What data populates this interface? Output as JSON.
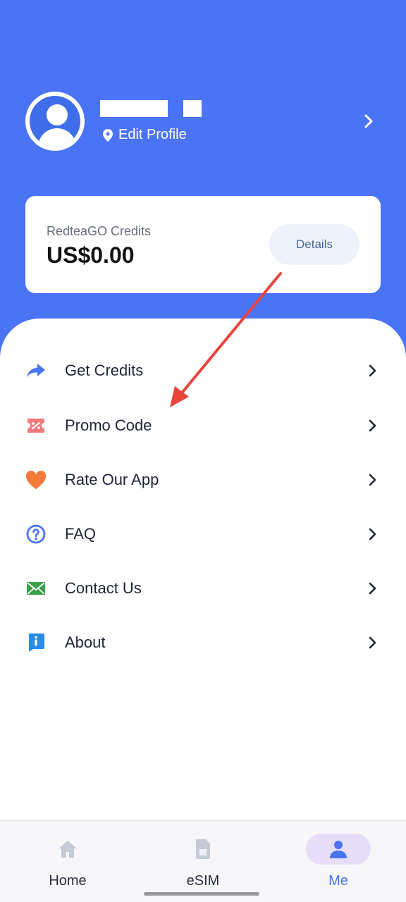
{
  "profile": {
    "edit_label": "Edit Profile"
  },
  "credits": {
    "label": "RedteaGO Credits",
    "value": "US$0.00",
    "details_label": "Details"
  },
  "menu": [
    {
      "label": "Get Credits",
      "icon": "share-arrow-icon",
      "color": "#4a74f5"
    },
    {
      "label": "Promo Code",
      "icon": "coupon-icon",
      "color": "#f07a7a"
    },
    {
      "label": "Rate Our App",
      "icon": "heart-icon",
      "color": "#f47a3c"
    },
    {
      "label": "FAQ",
      "icon": "question-circle-icon",
      "color": "#4a74f5"
    },
    {
      "label": "Contact Us",
      "icon": "envelope-icon",
      "color": "#3aa14a"
    },
    {
      "label": "About",
      "icon": "info-icon",
      "color": "#2b8be6"
    }
  ],
  "nav": [
    {
      "label": "Home",
      "icon": "home-icon"
    },
    {
      "label": "eSIM",
      "icon": "sim-card-icon"
    },
    {
      "label": "Me",
      "icon": "person-icon",
      "active": true
    }
  ],
  "colors": {
    "header": "#4a74f5",
    "annotation_arrow": "#e8453c",
    "active_nav_pill": "#e6def8"
  }
}
